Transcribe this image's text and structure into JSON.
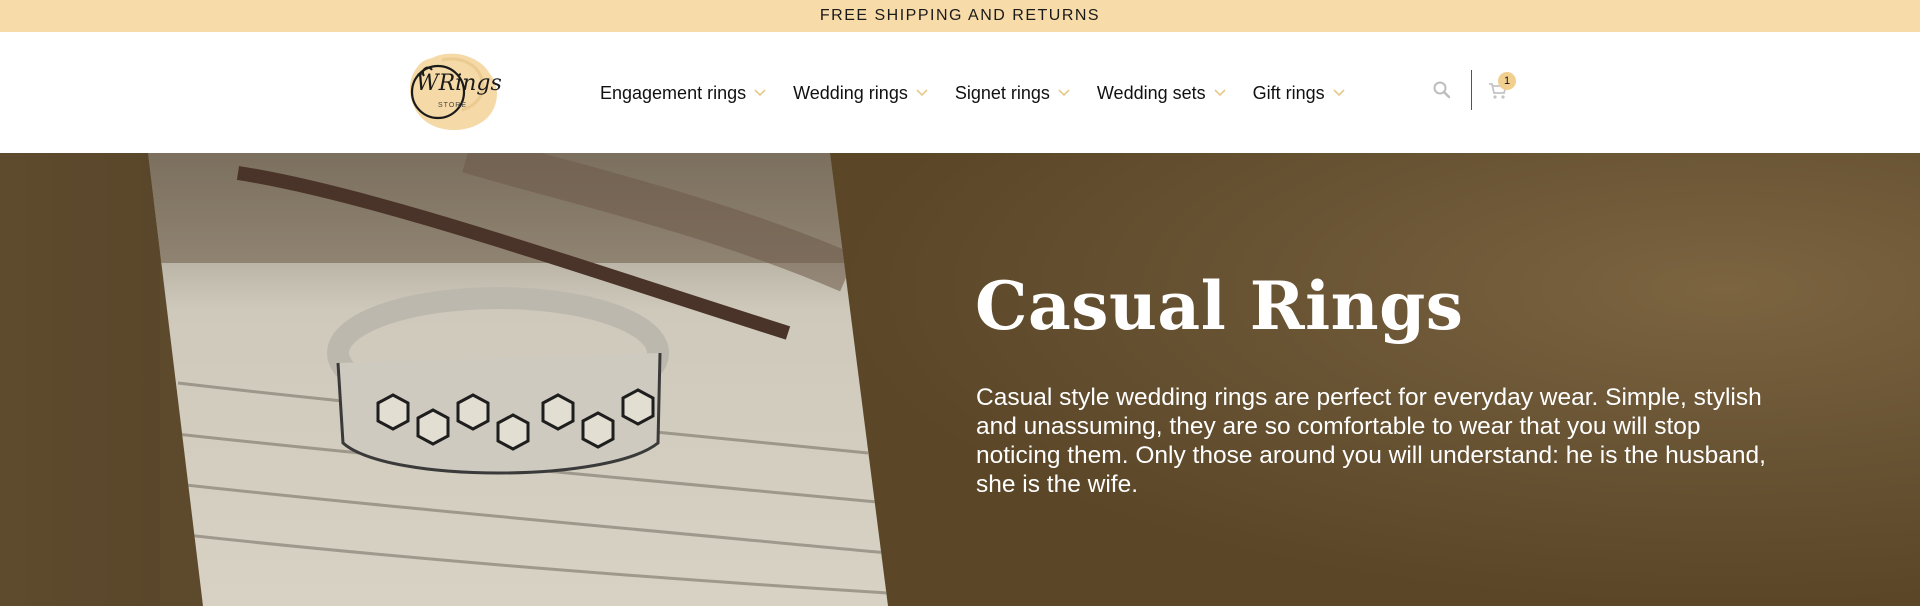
{
  "announcement": {
    "text": "FREE SHIPPING AND RETURNS"
  },
  "logo": {
    "text": "WRings",
    "sub": "STORE"
  },
  "nav": {
    "items": [
      {
        "label": "Engagement rings"
      },
      {
        "label": "Wedding rings"
      },
      {
        "label": "Signet rings"
      },
      {
        "label": "Wedding sets"
      },
      {
        "label": "Gift rings"
      }
    ]
  },
  "header_actions": {
    "search_icon": "search-icon",
    "cart_icon": "cart-icon",
    "cart_count": "1"
  },
  "hero": {
    "title": "Casual Rings",
    "description": "Casual style wedding rings are perfect for everyday wear. Simple, stylish and unassuming, they are so comfortable to wear that you will stop noticing them. Only those around you will understand: he is the husband, she is the wife."
  },
  "colors": {
    "announcement_bg": "#f7dba8",
    "hero_bg": "#5d4a2c",
    "accent": "#f1cf8e",
    "chevron": "#e9c98a"
  }
}
